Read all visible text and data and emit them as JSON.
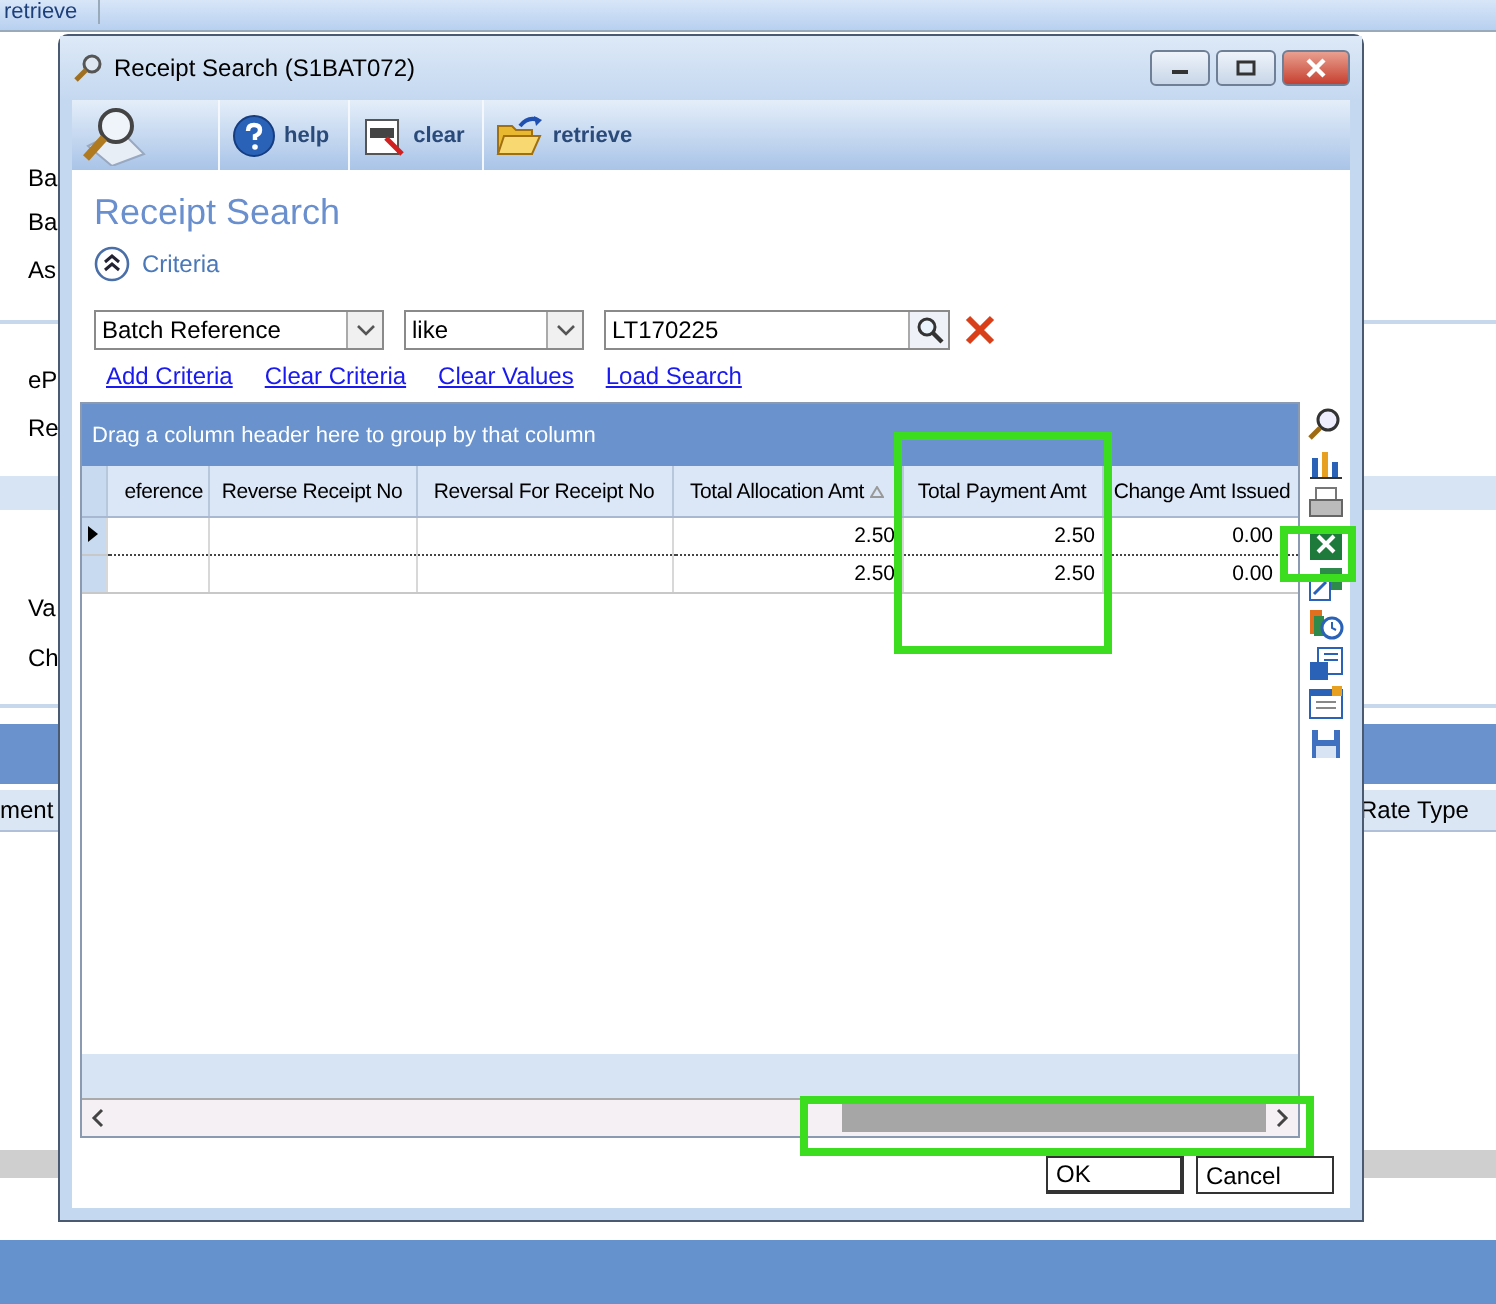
{
  "background_app": {
    "toolbar_label": "retrieve",
    "labels": [
      "Ba",
      "Ba",
      "As",
      "eP",
      "Re",
      "Va",
      "Ch"
    ],
    "columns": [
      "ment",
      "Rate Type"
    ]
  },
  "window": {
    "title": "Receipt Search (S1BAT072)"
  },
  "toolbar": [
    {
      "label": "help",
      "kind": "help"
    },
    {
      "label": "clear",
      "kind": "clear"
    },
    {
      "label": "retrieve",
      "kind": "folder"
    }
  ],
  "heading": "Receipt Search",
  "criteria": {
    "label": "Criteria",
    "expanded": true
  },
  "filter": {
    "field": "Batch Reference",
    "operator": "like",
    "value": "LT170225"
  },
  "links": [
    "Add Criteria",
    "Clear Criteria",
    "Clear Values",
    "Load Search"
  ],
  "grid": {
    "group_hint": "Drag a column header here to group by that column",
    "columns": [
      {
        "label": "eference",
        "sorted": false
      },
      {
        "label": "Reverse Receipt No",
        "sorted": false
      },
      {
        "label": "Reversal For Receipt No",
        "sorted": false
      },
      {
        "label": "Total Allocation Amt",
        "sorted": true
      },
      {
        "label": "Total Payment Amt",
        "sorted": false
      },
      {
        "label": "Change Amt Issued",
        "sorted": false
      }
    ],
    "rows": [
      {
        "current": true,
        "cells": [
          null,
          null,
          null,
          "2.50",
          "2.50",
          "0.00"
        ]
      },
      {
        "current": false,
        "cells": [
          null,
          null,
          null,
          "2.50",
          "2.50",
          "0.00"
        ]
      }
    ]
  },
  "buttons": [
    {
      "label": "OK",
      "default": true
    },
    {
      "label": "Cancel",
      "default": false
    }
  ]
}
